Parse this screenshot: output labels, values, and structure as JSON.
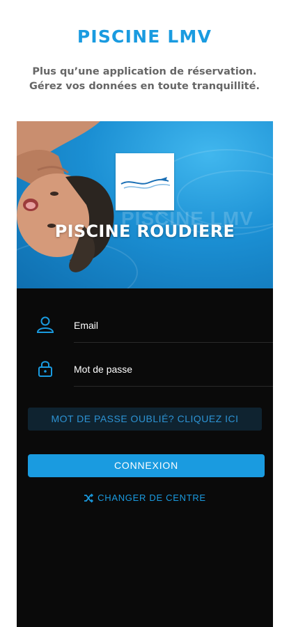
{
  "header": {
    "app_title": "PISCINE LMV",
    "tagline_line1": "Plus qu’une application de réservation.",
    "tagline_line2": "Gérez vos données en toute tranquillité."
  },
  "hero": {
    "watermark": "PISCINE LMV",
    "center_name": "PISCINE ROUDIERE"
  },
  "form": {
    "email_label": "Email",
    "password_label": "Mot de passe",
    "forgot_label": "MOT DE PASSE OUBLIÉ? CLIQUEZ ICI",
    "connect_label": "CONNEXION",
    "change_center_label": "CHANGER DE CENTRE"
  },
  "colors": {
    "accent": "#1a9be0",
    "background": "#0a0a0a"
  },
  "icons": [
    "user-icon",
    "lock-icon",
    "shuffle-icon",
    "wave-logo"
  ]
}
